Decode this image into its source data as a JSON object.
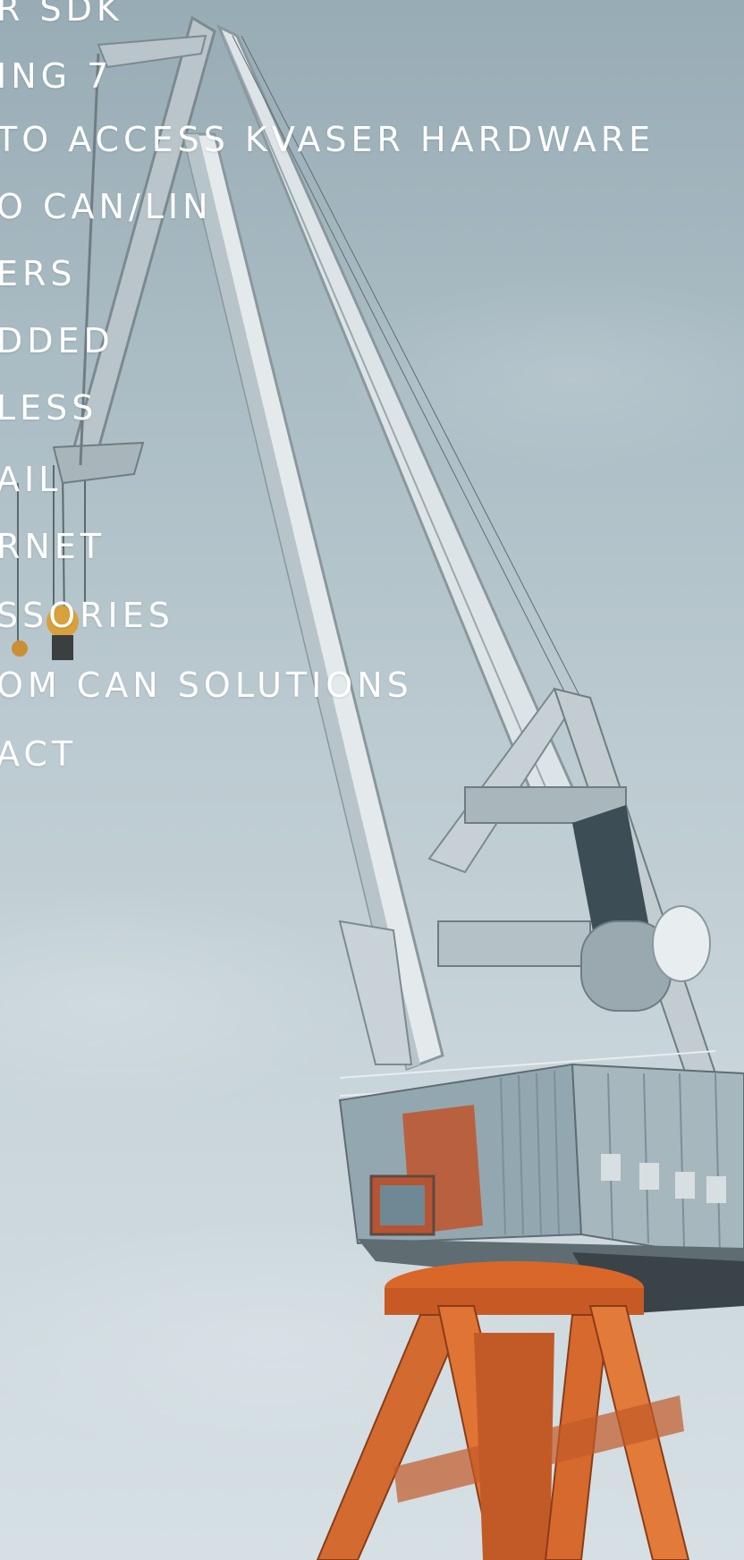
{
  "menu": {
    "items": [
      {
        "label": "R SDK"
      },
      {
        "label": "ING 7"
      },
      {
        "label": "TO ACCESS KVASER HARDWARE"
      },
      {
        "label": "O CAN/LIN"
      },
      {
        "label": "ERS"
      },
      {
        "label": "DDED"
      },
      {
        "label": "LESS"
      },
      {
        "label": "AIL"
      },
      {
        "label": "RNET"
      },
      {
        "label": "SSORIES"
      },
      {
        "label": "OM CAN SOLUTIONS"
      },
      {
        "label": "ACT"
      }
    ]
  },
  "colors": {
    "sky_top": "#98acb5",
    "sky_bottom": "#d6e0e4",
    "crane_boom": "#cfd8dc",
    "crane_cabin": "#8fa3ad",
    "crane_rust": "#c0552b",
    "crane_tower": "#d96a2c",
    "menu_text": "#ffffff"
  }
}
